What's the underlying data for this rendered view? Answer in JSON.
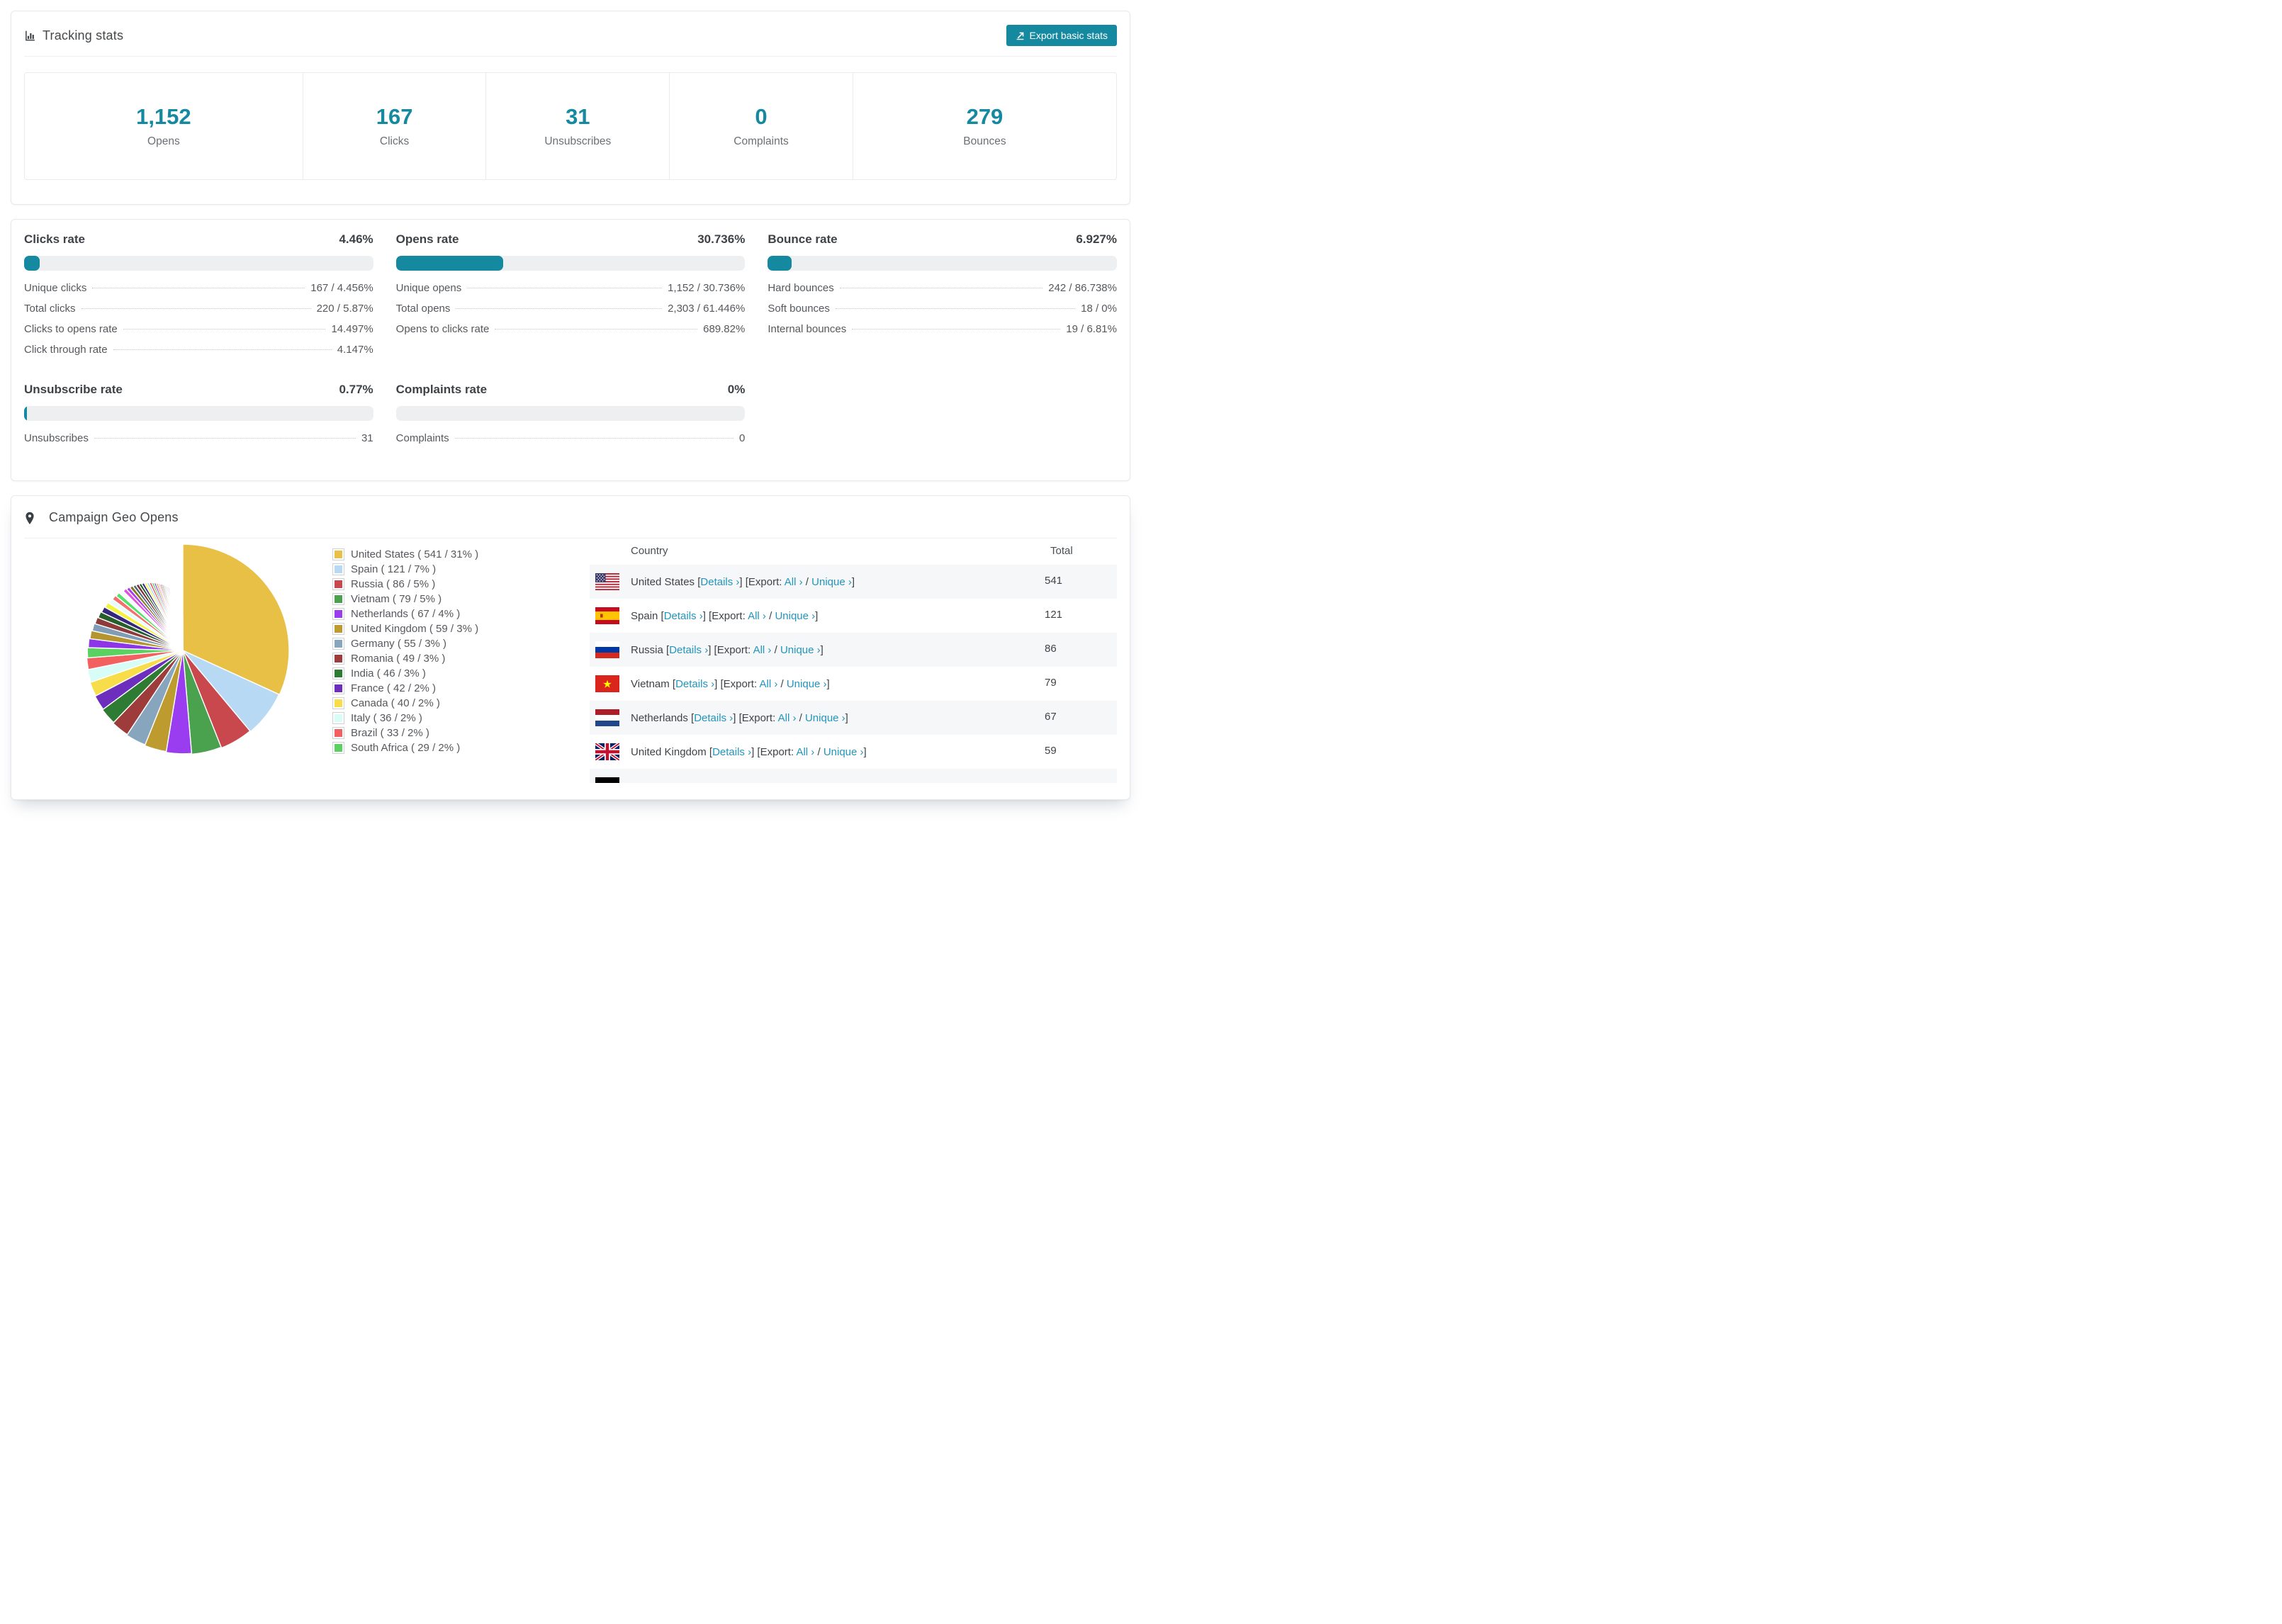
{
  "colors": {
    "accent": "#1489a0",
    "link": "#2395bc",
    "track": "#edeff1"
  },
  "tracking": {
    "title": "Tracking stats",
    "export_button": "Export basic stats"
  },
  "summary": [
    {
      "value": "1,152",
      "label": "Opens"
    },
    {
      "value": "167",
      "label": "Clicks"
    },
    {
      "value": "31",
      "label": "Unsubscribes"
    },
    {
      "value": "0",
      "label": "Complaints"
    },
    {
      "value": "279",
      "label": "Bounces"
    }
  ],
  "rates": {
    "clicks": {
      "title": "Clicks rate",
      "value": "4.46%",
      "percent": 4.46,
      "rows": [
        [
          "Unique clicks",
          "167 / 4.456%"
        ],
        [
          "Total clicks",
          "220 / 5.87%"
        ],
        [
          "Clicks to opens rate",
          "14.497%"
        ],
        [
          "Click through rate",
          "4.147%"
        ]
      ]
    },
    "opens": {
      "title": "Opens rate",
      "value": "30.736%",
      "percent": 30.736,
      "rows": [
        [
          "Unique opens",
          "1,152 / 30.736%"
        ],
        [
          "Total opens",
          "2,303 / 61.446%"
        ],
        [
          "Opens to clicks rate",
          "689.82%"
        ]
      ]
    },
    "bounce": {
      "title": "Bounce rate",
      "value": "6.927%",
      "percent": 6.927,
      "rows": [
        [
          "Hard bounces",
          "242 / 86.738%"
        ],
        [
          "Soft bounces",
          "18 / 0%"
        ],
        [
          "Internal bounces",
          "19 / 6.81%"
        ]
      ]
    },
    "unsubscribe": {
      "title": "Unsubscribe rate",
      "value": "0.77%",
      "percent": 0.77,
      "rows": [
        [
          "Unsubscribes",
          "31"
        ]
      ]
    },
    "complaints": {
      "title": "Complaints rate",
      "value": "0%",
      "percent": 0,
      "rows": [
        [
          "Complaints",
          "0"
        ]
      ]
    }
  },
  "geo": {
    "title": "Campaign Geo Opens",
    "table_headers": {
      "country": "Country",
      "total": "Total"
    },
    "links": {
      "details": "Details ›",
      "export_prefix": "[Export:",
      "all": "All ›",
      "sep": "/",
      "unique": "Unique ›"
    },
    "rows": [
      {
        "country": "United States",
        "total": "541",
        "flag": "us"
      },
      {
        "country": "Spain",
        "total": "121",
        "flag": "es"
      },
      {
        "country": "Russia",
        "total": "86",
        "flag": "ru"
      },
      {
        "country": "Vietnam",
        "total": "79",
        "flag": "vn"
      },
      {
        "country": "Netherlands",
        "total": "67",
        "flag": "nl"
      },
      {
        "country": "United Kingdom",
        "total": "59",
        "flag": "gb"
      },
      {
        "flag": "de",
        "partial": true
      }
    ]
  },
  "chart_data": {
    "type": "pie",
    "title": "Campaign Geo Opens",
    "legend_position": "right",
    "slices": [
      {
        "label": "United States",
        "value": 541,
        "pct": 31,
        "color": "#E9C046"
      },
      {
        "label": "Spain",
        "value": 121,
        "pct": 7,
        "color": "#B7D9F4"
      },
      {
        "label": "Russia",
        "value": 86,
        "pct": 5,
        "color": "#C9484D"
      },
      {
        "label": "Vietnam",
        "value": 79,
        "pct": 5,
        "color": "#4AA14E"
      },
      {
        "label": "Netherlands",
        "value": 67,
        "pct": 4,
        "color": "#9A3DF0"
      },
      {
        "label": "United Kingdom",
        "value": 59,
        "pct": 3,
        "color": "#BD9B2F"
      },
      {
        "label": "Germany",
        "value": 55,
        "pct": 3,
        "color": "#87A5BC"
      },
      {
        "label": "Romania",
        "value": 49,
        "pct": 3,
        "color": "#9E3C3C"
      },
      {
        "label": "India",
        "value": 46,
        "pct": 3,
        "color": "#2E7C34"
      },
      {
        "label": "France",
        "value": 42,
        "pct": 2,
        "color": "#6D2EBD"
      },
      {
        "label": "Canada",
        "value": 40,
        "pct": 2,
        "color": "#F6DD49"
      },
      {
        "label": "Italy",
        "value": 36,
        "pct": 2,
        "color": "#D8FCF6"
      },
      {
        "label": "Brazil",
        "value": 33,
        "pct": 2,
        "color": "#F2615F"
      },
      {
        "label": "South Africa",
        "value": 29,
        "pct": 2,
        "color": "#5AD161"
      }
    ],
    "other_slices_values": [
      26,
      24,
      22,
      20,
      19,
      18,
      17,
      16,
      15,
      14,
      13,
      12,
      11,
      11,
      10,
      10,
      9,
      9,
      8,
      8,
      8,
      7,
      7,
      7,
      6,
      6,
      6,
      5,
      5,
      5,
      5,
      4,
      4,
      4,
      4,
      3,
      3,
      3,
      3,
      3,
      2,
      2,
      2,
      2,
      2,
      2,
      2,
      1,
      1,
      1,
      1,
      1,
      1,
      1,
      1,
      1,
      1,
      1,
      1,
      1
    ],
    "other_palette": [
      "#8F35E8",
      "#B5952F",
      "#7F9DB5",
      "#8E3B3B",
      "#275F2C",
      "#35277D",
      "#F4F23F",
      "#E8FDFB",
      "#F56F6F",
      "#55E06B",
      "#F2FEFE",
      "#E44FE0",
      "#A93CF0",
      "#8A7A22",
      "#4A6B7D",
      "#7D2F35",
      "#1F5D28",
      "#3B2C86",
      "#FBF840",
      "#A8D4F2",
      "#E84B50",
      "#52C45A",
      "#8439D9",
      "#D9A53A",
      "#F884E2",
      "#C04848",
      "#4FA653",
      "#9A3DF0",
      "#BD9B2F",
      "#87A5BC"
    ]
  }
}
